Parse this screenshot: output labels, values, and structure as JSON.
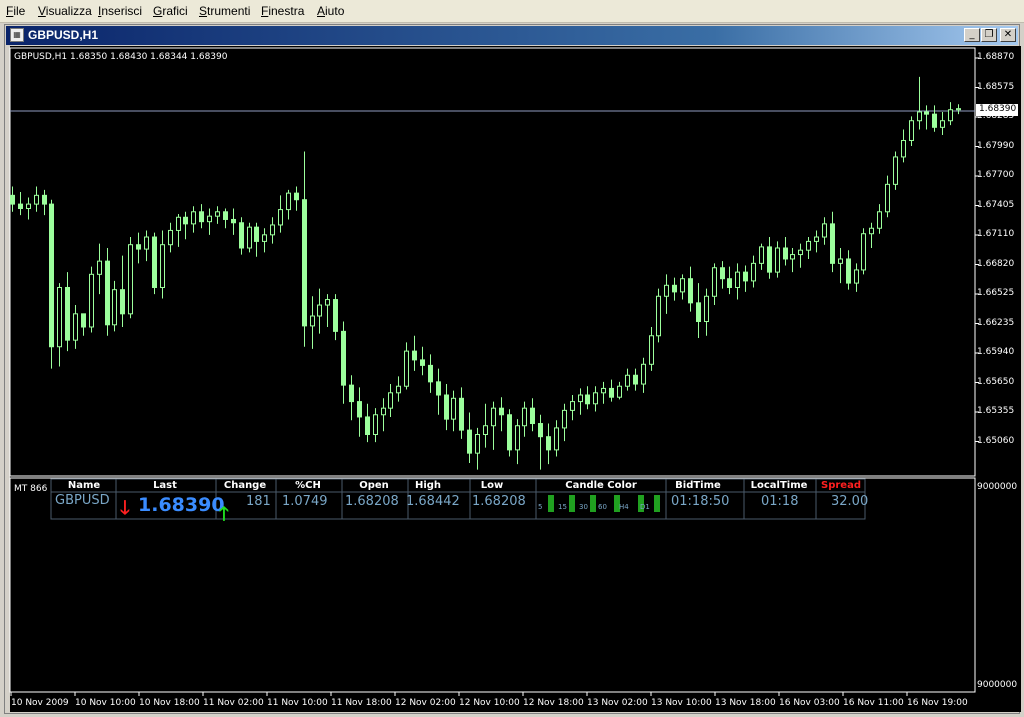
{
  "menu": [
    "File",
    "Visualizza",
    "Inserisci",
    "Grafici",
    "Strumenti",
    "Finestra",
    "Aiuto"
  ],
  "window": {
    "title": "GBPUSD,H1",
    "buttons": {
      "minimize": "_",
      "restore": "❐",
      "close": "✕"
    }
  },
  "chart_info": "GBPUSD,H1  1.68350 1.68430 1.68344 1.68390",
  "indicator_label": "MT 866",
  "price_axis": [
    "1.68870",
    "1.68575",
    "1.68285",
    "1.67990",
    "1.67700",
    "1.67405",
    "1.67110",
    "1.66820",
    "1.66525",
    "1.66235",
    "1.65940",
    "1.65650",
    "1.65355",
    "1.65060"
  ],
  "current_price_label": "1.68390",
  "indicator_axis": {
    "top": "9000000",
    "bottom": "9000000"
  },
  "time_axis": [
    "10 Nov 2009",
    "10 Nov 10:00",
    "10 Nov 18:00",
    "11 Nov 02:00",
    "11 Nov 10:00",
    "11 Nov 18:00",
    "12 Nov 02:00",
    "12 Nov 10:00",
    "12 Nov 18:00",
    "13 Nov 02:00",
    "13 Nov 10:00",
    "13 Nov 18:00",
    "16 Nov 03:00",
    "16 Nov 11:00",
    "16 Nov 19:00"
  ],
  "panel": {
    "headers": {
      "name": "Name",
      "last": "Last",
      "change": "Change",
      "pch": "%CH",
      "open": "Open",
      "high": "High",
      "low": "Low",
      "candle_color": "Candle Color",
      "bidtime": "BidTime",
      "localtime": "LocalTime",
      "spread": "Spread"
    },
    "values": {
      "name": "GBPUSD",
      "last": "1.68390",
      "change": "181",
      "pch": "1.0749",
      "open": "1.68208",
      "high": "1.68442",
      "low": "1.68208",
      "bidtime": "01:18:50",
      "localtime": "01:18",
      "spread": "32.00"
    },
    "candle_timeframes": [
      "5",
      "15",
      "30",
      "60",
      "H4",
      "D1"
    ],
    "colors": {
      "up_candle": "#9cff9c",
      "last_price": "#3a8cff",
      "arrow_down": "#ff2020",
      "arrow_up": "#20e020",
      "spread_header": "#ff2020",
      "panel_value": "#7aa7c7",
      "candle_bar": "#20a020"
    }
  },
  "chart_data": {
    "type": "candlestick",
    "symbol": "GBPUSD",
    "timeframe": "H1",
    "ylim": [
      1.6506,
      1.6887
    ],
    "current_price": 1.6839,
    "candles": [
      [
        1.676,
        1.6768,
        1.6745,
        1.6752
      ],
      [
        1.6752,
        1.6763,
        1.6742,
        1.6748
      ],
      [
        1.6748,
        1.6758,
        1.6738,
        1.6752
      ],
      [
        1.6752,
        1.6768,
        1.6745,
        1.676
      ],
      [
        1.676,
        1.6765,
        1.6742,
        1.6752
      ],
      [
        1.6752,
        1.6756,
        1.6602,
        1.6622
      ],
      [
        1.6622,
        1.668,
        1.6604,
        1.6676
      ],
      [
        1.6676,
        1.669,
        1.6618,
        1.6628
      ],
      [
        1.6628,
        1.666,
        1.662,
        1.6652
      ],
      [
        1.6652,
        1.665,
        1.6632,
        1.664
      ],
      [
        1.664,
        1.6695,
        1.6635,
        1.6688
      ],
      [
        1.6688,
        1.6716,
        1.667,
        1.67
      ],
      [
        1.67,
        1.6712,
        1.6632,
        1.6642
      ],
      [
        1.6642,
        1.6682,
        1.6636,
        1.6674
      ],
      [
        1.6674,
        1.6705,
        1.664,
        1.6652
      ],
      [
        1.6652,
        1.6722,
        1.6648,
        1.6715
      ],
      [
        1.6715,
        1.6726,
        1.6698,
        1.6711
      ],
      [
        1.6711,
        1.6728,
        1.67,
        1.6722
      ],
      [
        1.6722,
        1.6726,
        1.667,
        1.6676
      ],
      [
        1.6676,
        1.6728,
        1.6666,
        1.6715
      ],
      [
        1.6715,
        1.6735,
        1.6708,
        1.6728
      ],
      [
        1.6728,
        1.6743,
        1.6713,
        1.674
      ],
      [
        1.674,
        1.6745,
        1.672,
        1.6734
      ],
      [
        1.6734,
        1.675,
        1.6726,
        1.6745
      ],
      [
        1.6745,
        1.6752,
        1.673,
        1.6736
      ],
      [
        1.6736,
        1.6748,
        1.6724,
        1.6741
      ],
      [
        1.6741,
        1.675,
        1.6734,
        1.6745
      ],
      [
        1.6745,
        1.6748,
        1.673,
        1.6738
      ],
      [
        1.6738,
        1.6748,
        1.6724,
        1.6735
      ],
      [
        1.6735,
        1.674,
        1.6706,
        1.6712
      ],
      [
        1.6712,
        1.6735,
        1.6708,
        1.6731
      ],
      [
        1.6731,
        1.6735,
        1.6704,
        1.6718
      ],
      [
        1.6718,
        1.673,
        1.6708,
        1.6724
      ],
      [
        1.6724,
        1.674,
        1.6716,
        1.6733
      ],
      [
        1.6733,
        1.676,
        1.6726,
        1.6747
      ],
      [
        1.6747,
        1.6765,
        1.6738,
        1.6762
      ],
      [
        1.6762,
        1.6768,
        1.6746,
        1.6756
      ],
      [
        1.6756,
        1.68,
        1.6622,
        1.6641
      ],
      [
        1.6641,
        1.6668,
        1.662,
        1.665
      ],
      [
        1.665,
        1.6675,
        1.6634,
        1.666
      ],
      [
        1.666,
        1.667,
        1.664,
        1.6665
      ],
      [
        1.6665,
        1.667,
        1.6628,
        1.6636
      ],
      [
        1.6636,
        1.6645,
        1.657,
        1.6587
      ],
      [
        1.6587,
        1.6596,
        1.6555,
        1.6572
      ],
      [
        1.6572,
        1.6585,
        1.654,
        1.6558
      ],
      [
        1.6558,
        1.657,
        1.6535,
        1.6542
      ],
      [
        1.6542,
        1.6566,
        1.6535,
        1.656
      ],
      [
        1.656,
        1.6575,
        1.6545,
        1.6566
      ],
      [
        1.6566,
        1.6588,
        1.6558,
        1.658
      ],
      [
        1.658,
        1.6595,
        1.6572,
        1.6586
      ],
      [
        1.6586,
        1.6626,
        1.6583,
        1.6618
      ],
      [
        1.6618,
        1.6632,
        1.66,
        1.661
      ],
      [
        1.661,
        1.6622,
        1.6596,
        1.6605
      ],
      [
        1.6605,
        1.6615,
        1.658,
        1.659
      ],
      [
        1.659,
        1.6602,
        1.656,
        1.6578
      ],
      [
        1.6578,
        1.6588,
        1.6546,
        1.6556
      ],
      [
        1.6556,
        1.6582,
        1.6545,
        1.6575
      ],
      [
        1.6575,
        1.6585,
        1.6538,
        1.6546
      ],
      [
        1.6546,
        1.6562,
        1.6516,
        1.6525
      ],
      [
        1.6525,
        1.6548,
        1.651,
        1.6542
      ],
      [
        1.6542,
        1.657,
        1.653,
        1.655
      ],
      [
        1.655,
        1.6572,
        1.6528,
        1.6566
      ],
      [
        1.6566,
        1.6576,
        1.6545,
        1.656
      ],
      [
        1.656,
        1.6565,
        1.6522,
        1.6528
      ],
      [
        1.6528,
        1.6556,
        1.6515,
        1.655
      ],
      [
        1.655,
        1.6572,
        1.654,
        1.6566
      ],
      [
        1.6566,
        1.6575,
        1.6545,
        1.6552
      ],
      [
        1.6552,
        1.656,
        1.651,
        1.654
      ],
      [
        1.654,
        1.6552,
        1.6515,
        1.6528
      ],
      [
        1.6528,
        1.6555,
        1.6522,
        1.6548
      ],
      [
        1.6548,
        1.657,
        1.6536,
        1.6564
      ],
      [
        1.6564,
        1.6578,
        1.6555,
        1.6572
      ],
      [
        1.6572,
        1.6584,
        1.656,
        1.6578
      ],
      [
        1.6578,
        1.6586,
        1.6565,
        1.657
      ],
      [
        1.657,
        1.6586,
        1.6563,
        1.658
      ],
      [
        1.658,
        1.659,
        1.657,
        1.6584
      ],
      [
        1.6584,
        1.6592,
        1.6572,
        1.6576
      ],
      [
        1.6576,
        1.659,
        1.6574,
        1.6586
      ],
      [
        1.6586,
        1.6602,
        1.6582,
        1.6596
      ],
      [
        1.6596,
        1.6602,
        1.6582,
        1.6588
      ],
      [
        1.6588,
        1.6612,
        1.658,
        1.6606
      ],
      [
        1.6606,
        1.664,
        1.66,
        1.6632
      ],
      [
        1.6632,
        1.6675,
        1.6626,
        1.6668
      ],
      [
        1.6668,
        1.6688,
        1.6652,
        1.6678
      ],
      [
        1.6678,
        1.6685,
        1.6664,
        1.6672
      ],
      [
        1.6672,
        1.6688,
        1.6665,
        1.6684
      ],
      [
        1.6684,
        1.6695,
        1.6654,
        1.6662
      ],
      [
        1.6662,
        1.668,
        1.663,
        1.6645
      ],
      [
        1.6645,
        1.6675,
        1.6632,
        1.6668
      ],
      [
        1.6668,
        1.6698,
        1.666,
        1.6694
      ],
      [
        1.6694,
        1.67,
        1.6675,
        1.6684
      ],
      [
        1.6684,
        1.6695,
        1.667,
        1.6676
      ],
      [
        1.6676,
        1.6698,
        1.6665,
        1.669
      ],
      [
        1.669,
        1.6696,
        1.6672,
        1.6682
      ],
      [
        1.6682,
        1.6705,
        1.6676,
        1.6698
      ],
      [
        1.6698,
        1.6716,
        1.6692,
        1.6713
      ],
      [
        1.6713,
        1.6722,
        1.6684,
        1.669
      ],
      [
        1.669,
        1.6718,
        1.6685,
        1.6712
      ],
      [
        1.6712,
        1.6722,
        1.6696,
        1.6702
      ],
      [
        1.6702,
        1.6712,
        1.669,
        1.6706
      ],
      [
        1.6706,
        1.6716,
        1.6694,
        1.671
      ],
      [
        1.671,
        1.6722,
        1.6702,
        1.6718
      ],
      [
        1.6718,
        1.6728,
        1.6708,
        1.6722
      ],
      [
        1.6722,
        1.674,
        1.6715,
        1.6734
      ],
      [
        1.6734,
        1.6745,
        1.669,
        1.6698
      ],
      [
        1.6698,
        1.6712,
        1.668,
        1.6702
      ],
      [
        1.6702,
        1.671,
        1.6674,
        1.668
      ],
      [
        1.668,
        1.6698,
        1.6672,
        1.6692
      ],
      [
        1.6692,
        1.673,
        1.6688,
        1.6725
      ],
      [
        1.6725,
        1.6735,
        1.6712,
        1.673
      ],
      [
        1.673,
        1.6752,
        1.6725,
        1.6745
      ],
      [
        1.6745,
        1.6778,
        1.674,
        1.677
      ],
      [
        1.677,
        1.68,
        1.6765,
        1.6795
      ],
      [
        1.6795,
        1.682,
        1.679,
        1.681
      ],
      [
        1.681,
        1.6832,
        1.6805,
        1.6828
      ],
      [
        1.6828,
        1.6868,
        1.682,
        1.6836
      ],
      [
        1.6836,
        1.6842,
        1.682,
        1.6834
      ],
      [
        1.6834,
        1.6842,
        1.6818,
        1.6822
      ],
      [
        1.6822,
        1.6836,
        1.6815,
        1.6828
      ],
      [
        1.6828,
        1.6845,
        1.6824,
        1.6838
      ],
      [
        1.6838,
        1.6843,
        1.6834,
        1.6839
      ]
    ]
  }
}
